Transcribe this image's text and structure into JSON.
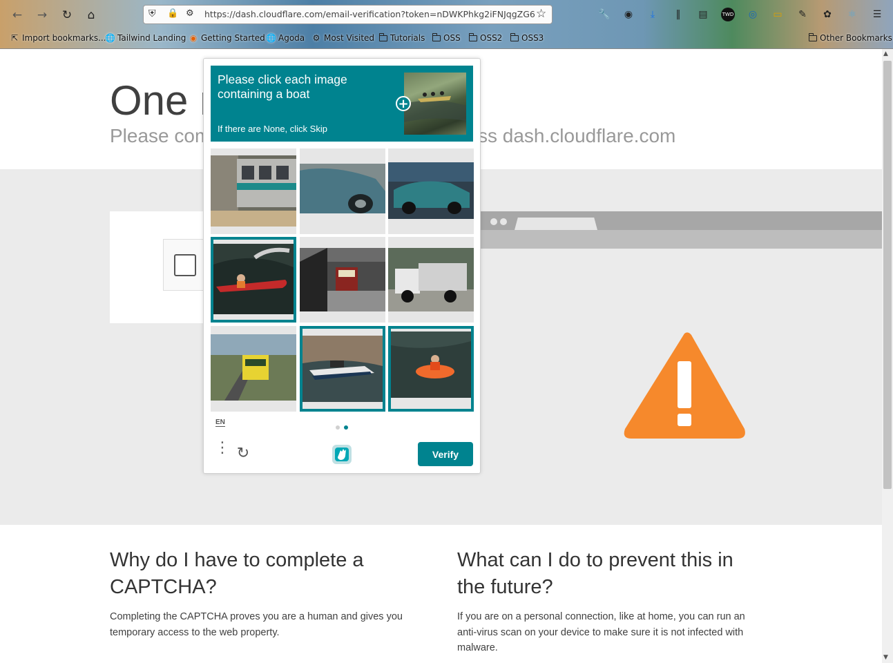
{
  "browser": {
    "url": "https://dash.cloudflare.com/email-verification?token=nDWKPhkg2iFNJqgZG6",
    "bookmarks": [
      "Import bookmarks...",
      "Tailwind Landing",
      "Getting Started",
      "Agoda",
      "Most Visited",
      "Tutorials",
      "OSS",
      "OSS2",
      "OSS3"
    ],
    "other_bookmarks": "Other Bookmarks"
  },
  "page": {
    "title": "One m",
    "subtitle_left": "Please com",
    "subtitle_right": "ss dash.cloudflare.com",
    "why_heading": "Why do I have to complete a CAPTCHA?",
    "why_text": "Completing the CAPTCHA proves you are a human and gives you temporary access to the web property.",
    "prevent_heading": "What can I do to prevent this in the future?",
    "prevent_text": "If you are on a personal connection, like at home, you can run an anti-virus scan on your device to make sure it is not infected with malware.",
    "warning_color": "#f6892c"
  },
  "captcha": {
    "prompt": "Please click each image containing a boat",
    "hint": "If there are None, click Skip",
    "language": "EN",
    "verify_label": "Verify",
    "accent": "#00838f",
    "page_count": 2,
    "current_page": 2,
    "tiles": [
      {
        "name": "train-platform",
        "selected": false
      },
      {
        "name": "blue-car",
        "selected": false
      },
      {
        "name": "teal-car-garage",
        "selected": false
      },
      {
        "name": "red-kayak",
        "selected": true
      },
      {
        "name": "red-train-station",
        "selected": false
      },
      {
        "name": "white-truck",
        "selected": false
      },
      {
        "name": "yellow-bus-game",
        "selected": false
      },
      {
        "name": "speedboat-rocks",
        "selected": true
      },
      {
        "name": "orange-raft",
        "selected": true
      }
    ]
  }
}
